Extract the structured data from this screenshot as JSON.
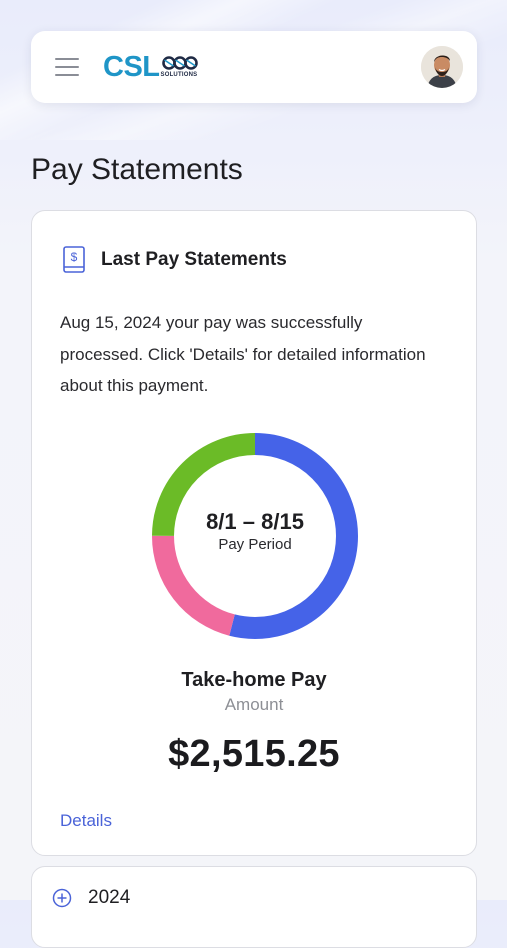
{
  "header": {
    "logo_text": "CSL",
    "logo_subtext": "SOLUTIONS",
    "menu_icon": "hamburger-menu-icon",
    "avatar_icon": "user-avatar"
  },
  "page": {
    "title": "Pay Statements"
  },
  "last_statement": {
    "icon": "dollar-document-icon",
    "title": "Last Pay Statements",
    "description": "Aug 15, 2024 your pay was successfully processed. Click 'Details' for detailed information about this payment.",
    "period_range": "8/1 – 8/15",
    "period_label": "Pay Period",
    "take_home_label": "Take-home Pay",
    "amount_label": "Amount",
    "amount_value": "$2,515.25",
    "details_link": "Details"
  },
  "chart_data": {
    "type": "pie",
    "segments": [
      {
        "color": "#4563e8",
        "fraction": 0.54
      },
      {
        "color": "#f06a9d",
        "fraction": 0.21
      },
      {
        "color": "#6bbb27",
        "fraction": 0.25
      }
    ]
  },
  "year_section": {
    "icon": "plus-circle-icon",
    "label": "2024"
  },
  "colors": {
    "brand": "#1f95c7",
    "link": "#4a63d8",
    "blue_segment": "#4563e8",
    "pink_segment": "#f06a9d",
    "green_segment": "#6bbb27"
  }
}
